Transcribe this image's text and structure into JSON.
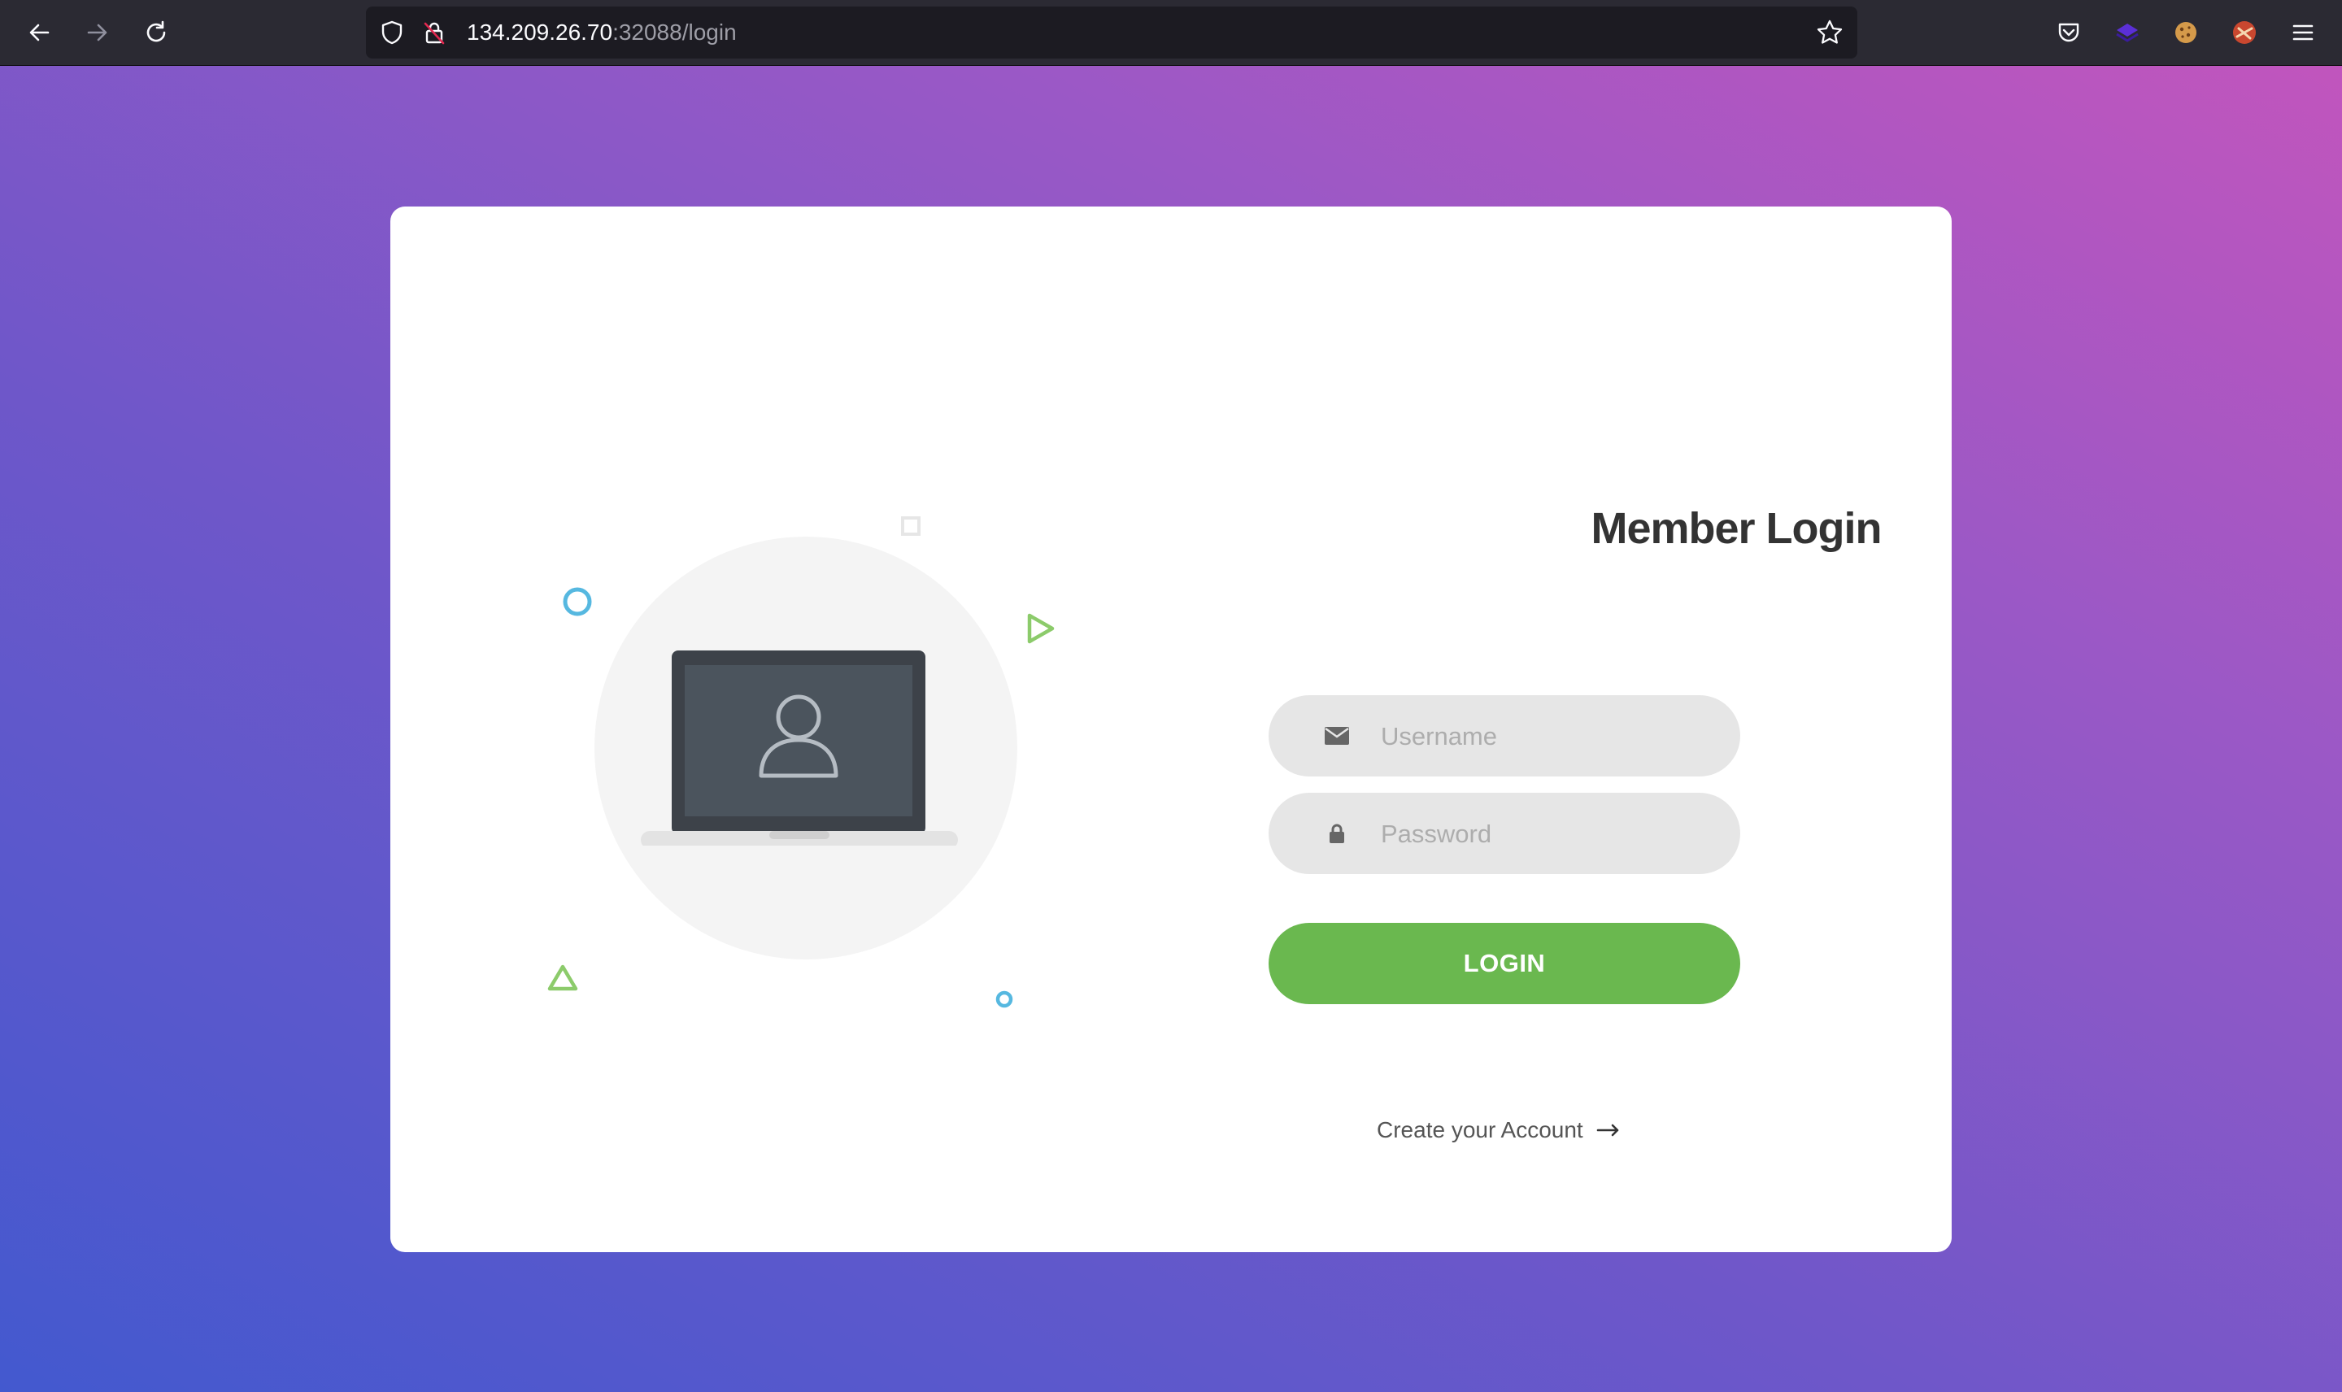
{
  "browser": {
    "url_host": "134.209.26.70",
    "url_path": ":32088/login",
    "icons": [
      "back-arrow-icon",
      "forward-arrow-icon",
      "reload-icon",
      "shield-icon",
      "insecure-lock-icon",
      "star-bookmark-icon",
      "pocket-icon",
      "extension-layers-icon",
      "cookie-icon",
      "extension-avatar-icon",
      "hamburger-menu-icon"
    ]
  },
  "login": {
    "title": "Member Login",
    "username_placeholder": "Username",
    "password_placeholder": "Password",
    "button_label": "LOGIN",
    "create_account_label": "Create your Account"
  },
  "colors": {
    "accent_green": "#6ab84f",
    "deco_blue": "#56b8e0",
    "deco_green": "#8ccb6b",
    "gradient_top_right": "#c155bd",
    "gradient_bottom_left": "#4359cf"
  }
}
